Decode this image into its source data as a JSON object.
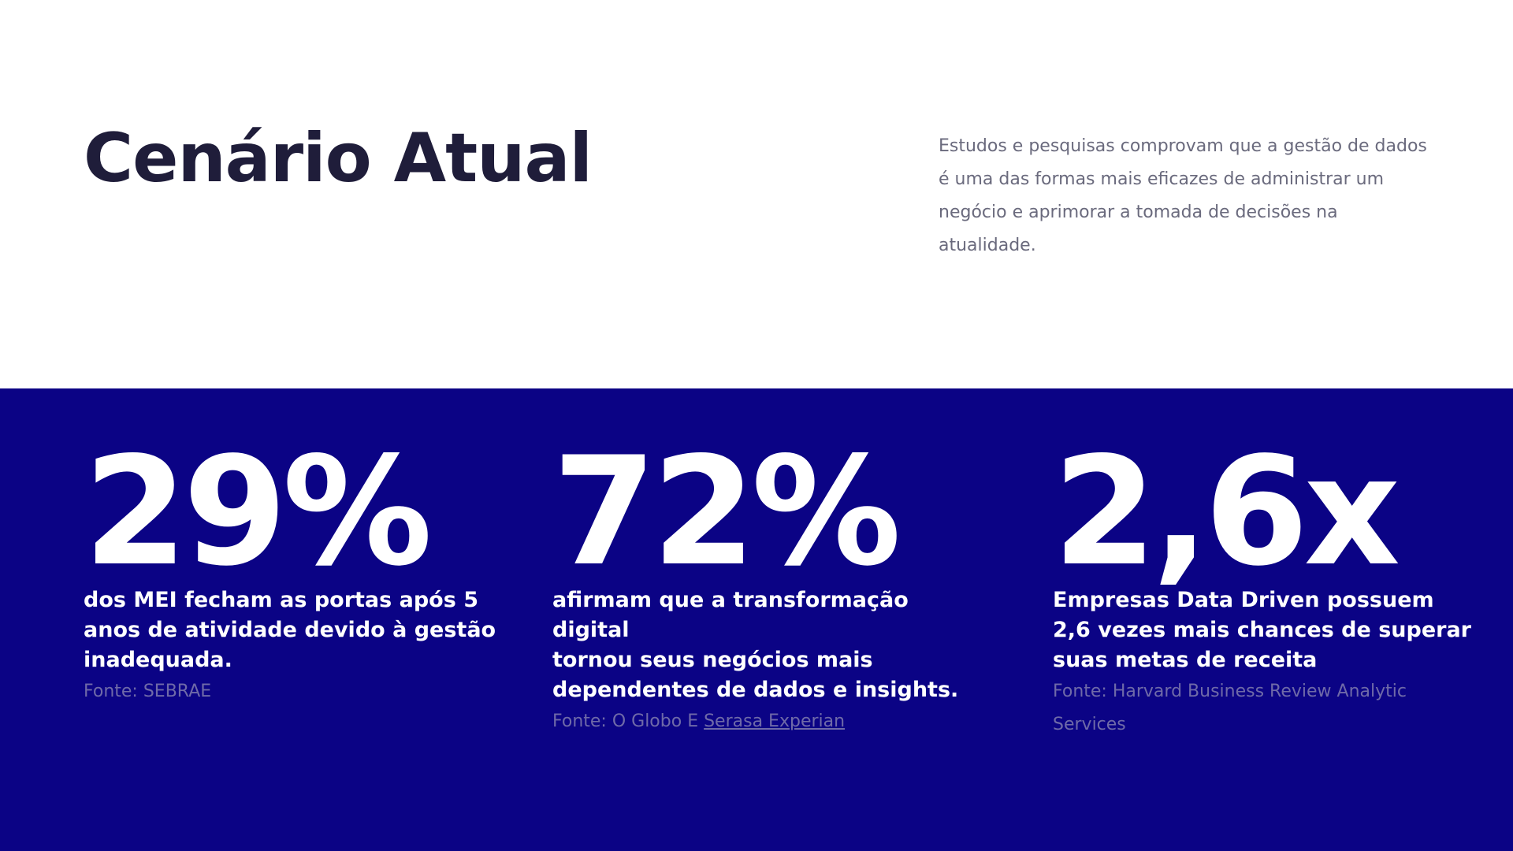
{
  "header": {
    "title": "Cenário Atual",
    "intro": "Estudos e pesquisas comprovam que a gestão de dados é uma das formas mais eficazes de administrar um negócio e aprimorar a tomada de decisões na atualidade."
  },
  "stats": [
    {
      "value": "29%",
      "description": "dos MEI fecham as portas após 5\nanos de atividade devido à gestão\n inadequada.",
      "source_prefix": "Fonte: SEBRAE",
      "source_link": ""
    },
    {
      "value": "72%",
      "description": "afirmam que a transformação digital\ntornou seus negócios mais\ndependentes de dados e insights.",
      "source_prefix": "Fonte: O Globo E ",
      "source_link": "Serasa Experian"
    },
    {
      "value": "2,6x",
      "description": "Empresas Data Driven possuem\n2,6 vezes mais chances de superar\nsuas metas de receita",
      "source_prefix": "Fonte: Harvard Business Review Analytic Services",
      "source_link": ""
    }
  ],
  "colors": {
    "background_top": "#ffffff",
    "background_stats": "#0b0385",
    "title": "#1f1d3a",
    "intro_text": "#6a6a7d",
    "stat_text": "#ffffff",
    "source_text": "#6f6aa8"
  }
}
